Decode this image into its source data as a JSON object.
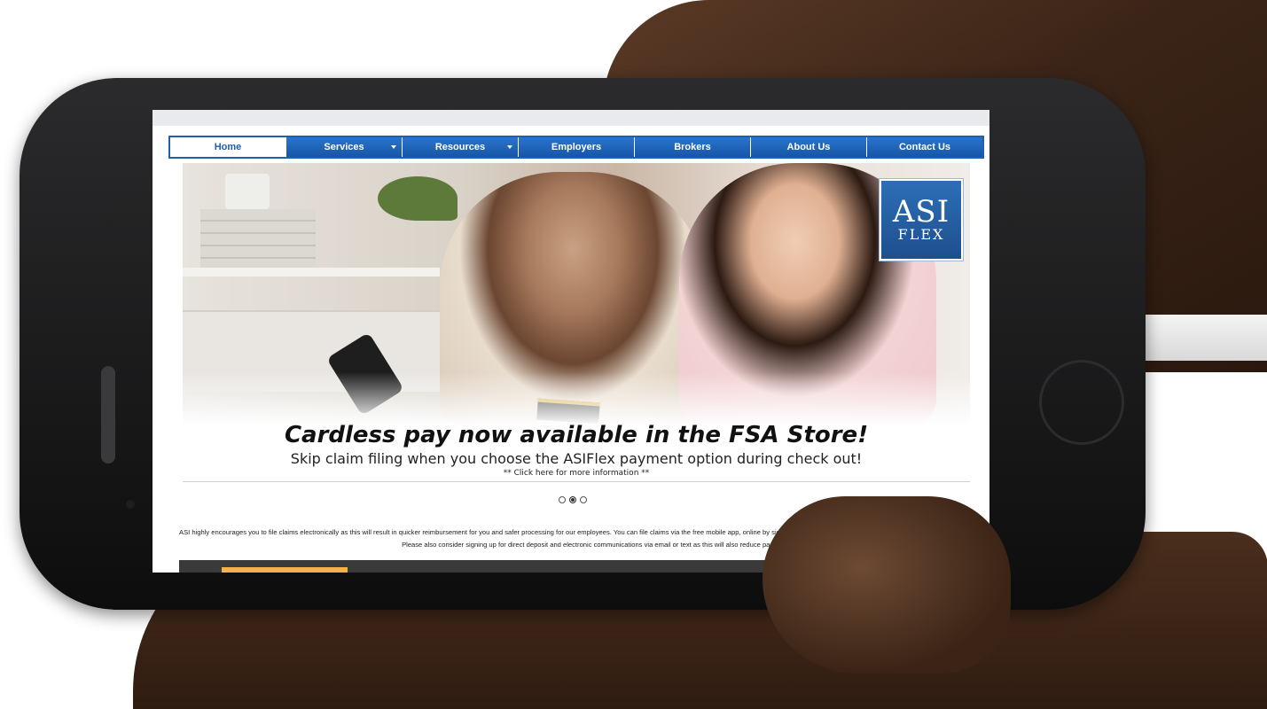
{
  "nav": {
    "items": [
      {
        "label": "Home",
        "active": true,
        "dropdown": false
      },
      {
        "label": "Services",
        "active": false,
        "dropdown": true
      },
      {
        "label": "Resources",
        "active": false,
        "dropdown": true
      },
      {
        "label": "Employers",
        "active": false,
        "dropdown": false
      },
      {
        "label": "Brokers",
        "active": false,
        "dropdown": false
      },
      {
        "label": "About Us",
        "active": false,
        "dropdown": false
      },
      {
        "label": "Contact Us",
        "active": false,
        "dropdown": false
      }
    ]
  },
  "logo": {
    "top": "ASI",
    "bottom": "FLEX"
  },
  "slide": {
    "headline": "Cardless pay now available in the FSA Store!",
    "subline": "Skip claim filing when you choose the ASIFlex payment option during check out!",
    "link": "** Click here for more information **"
  },
  "carousel": {
    "count": 3,
    "active_index": 1
  },
  "notice": {
    "line1": "ASI highly encourages you to file claims electronically as this will result in quicker reimbursement for you and safer processing for our employees. You can file claims via the free mobile app, online by signing into yo",
    "line2": "Please also consider signing up for direct deposit and electronic communications via email or text as this will also reduce paper usage and wait times."
  },
  "colors": {
    "nav_blue": "#1f5fb0",
    "accent_orange": "#f2b34a"
  }
}
